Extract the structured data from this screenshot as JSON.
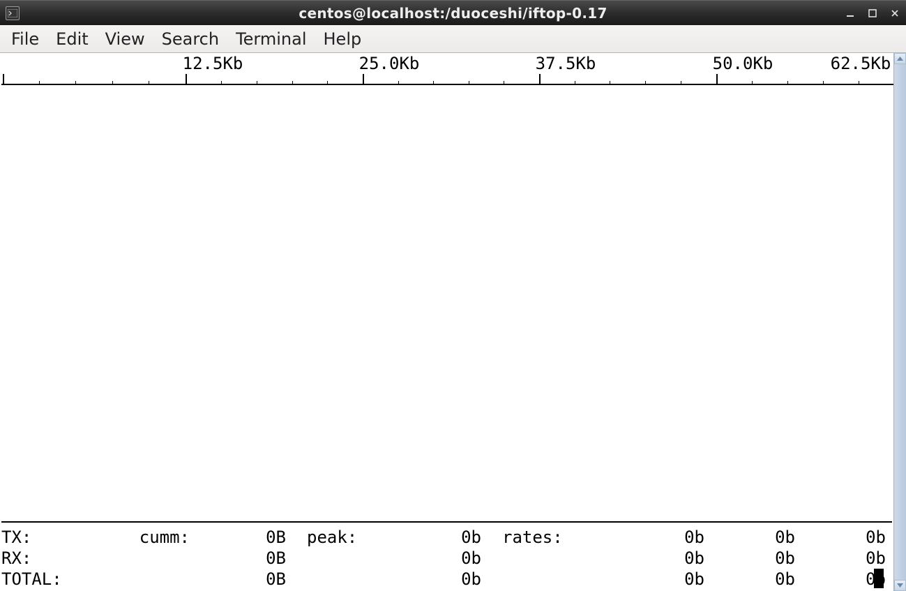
{
  "window": {
    "title": "centos@localhost:/duoceshi/iftop-0.17"
  },
  "menubar": {
    "items": [
      "File",
      "Edit",
      "View",
      "Search",
      "Terminal",
      "Help"
    ]
  },
  "scale": {
    "labels": [
      "12.5Kb",
      "25.0Kb",
      "37.5Kb",
      "50.0Kb",
      "62.5Kb"
    ]
  },
  "stats": {
    "headers": {
      "cumm": "cumm:",
      "peak": "peak:",
      "rates": "rates:"
    },
    "rows": [
      {
        "label": "TX:",
        "cumm": "0B",
        "peak": "0b",
        "r1": "0b",
        "r2": "0b",
        "r3": "0b"
      },
      {
        "label": "RX:",
        "cumm": "0B",
        "peak": "0b",
        "r1": "0b",
        "r2": "0b",
        "r3": "0b"
      },
      {
        "label": "TOTAL:",
        "cumm": "0B",
        "peak": "0b",
        "r1": "0b",
        "r2": "0b",
        "r3": "0b"
      }
    ]
  }
}
